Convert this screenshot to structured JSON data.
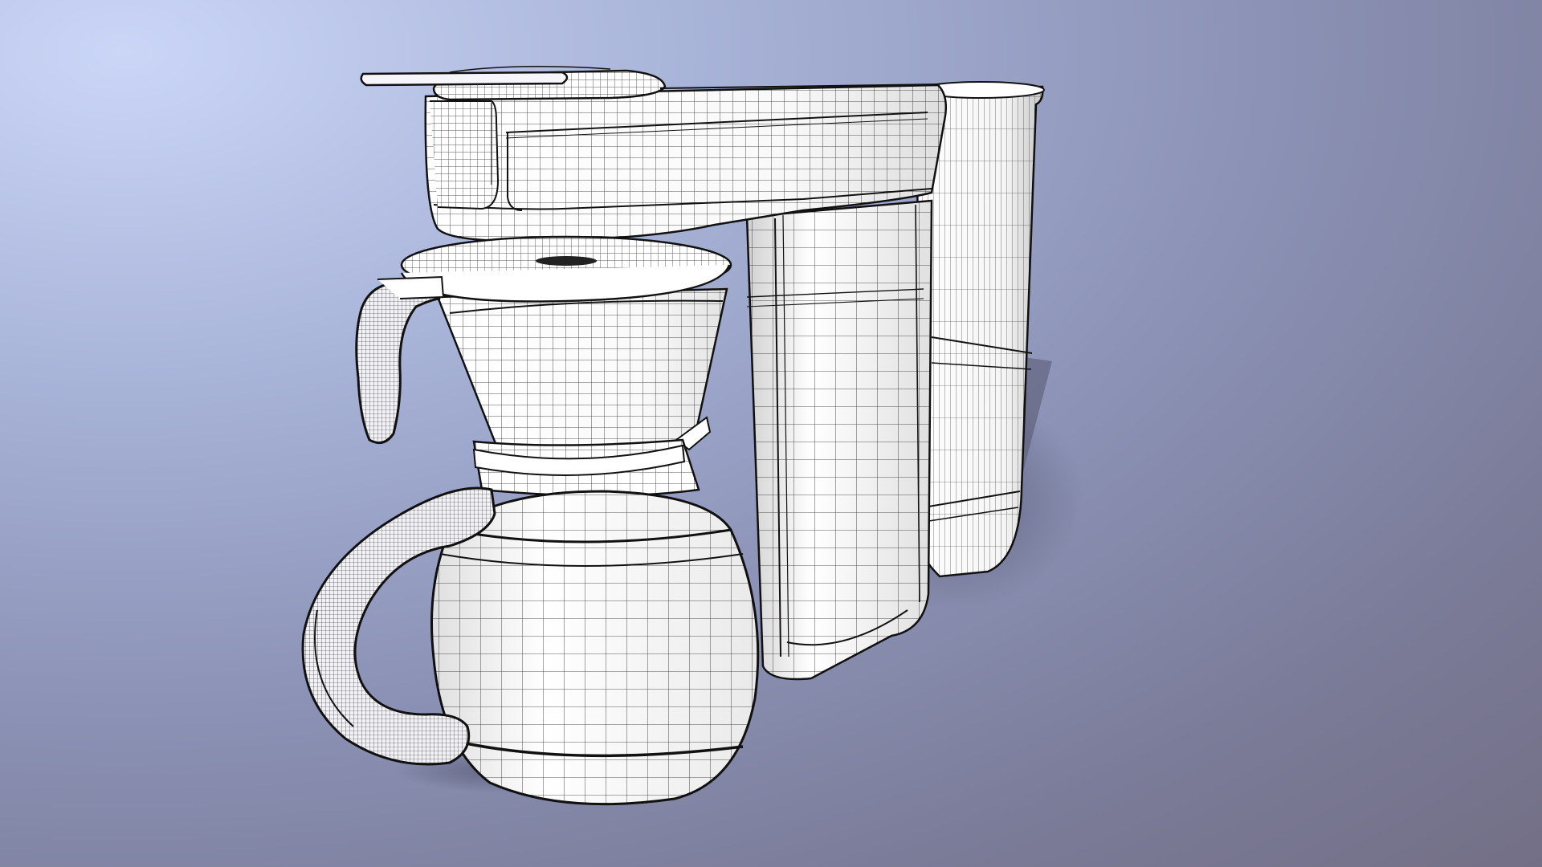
{
  "scene": {
    "subject": "coffee-maker-wireframe",
    "render_mode": "wireframe-on-white-shading",
    "colors": {
      "background_light": "#cbd6f7",
      "background_mid": "#8d94b8",
      "background_dark": "#736f86",
      "surface": "#ffffff",
      "surface_shade": "#d9d9e6",
      "wire": "#1a1a1a",
      "shadow": "#55566e"
    }
  }
}
